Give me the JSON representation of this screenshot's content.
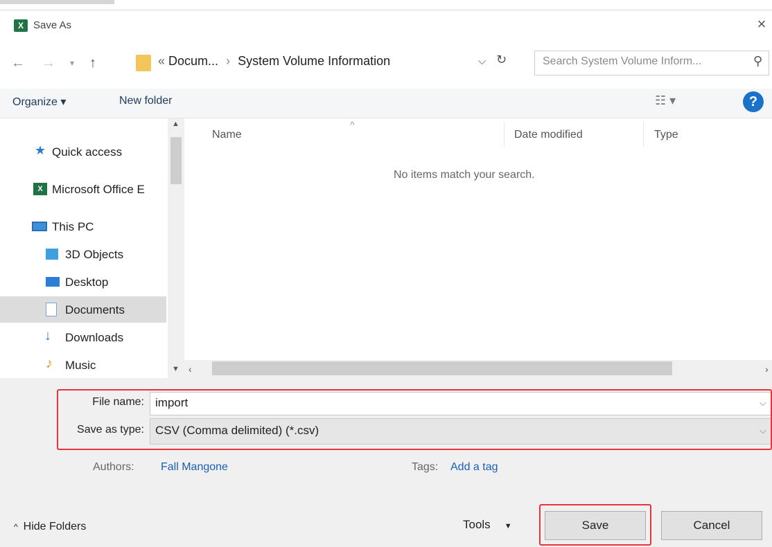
{
  "window": {
    "title": "Save As",
    "app_icon": "excel-icon"
  },
  "nav": {
    "breadcrumb_prefix": "«",
    "breadcrumb_parent": "Docum...",
    "breadcrumb_separator": "›",
    "breadcrumb_current": "System Volume Information",
    "search_placeholder": "Search System Volume Inform..."
  },
  "toolbar": {
    "organize": "Organize ▾",
    "new_folder": "New folder"
  },
  "sidebar": {
    "items": [
      {
        "label": "Quick access",
        "icon": "star-icon",
        "color": "#2b7cd3"
      },
      {
        "label": "Microsoft Office E",
        "icon": "excel-icon",
        "color": "#217346"
      },
      {
        "label": "This PC",
        "icon": "computer-icon",
        "color": "#3c8fd8"
      },
      {
        "label": "3D Objects",
        "icon": "cube-icon",
        "color": "#3fa0e0"
      },
      {
        "label": "Desktop",
        "icon": "desktop-icon",
        "color": "#2a7fd4"
      },
      {
        "label": "Documents",
        "icon": "document-icon",
        "color": "#7aa6d6"
      },
      {
        "label": "Downloads",
        "icon": "download-icon",
        "color": "#2b7cd3"
      },
      {
        "label": "Music",
        "icon": "music-icon",
        "color": "#e09a2a"
      }
    ]
  },
  "files": {
    "columns": [
      "Name",
      "Date modified",
      "Type"
    ],
    "empty_message": "No items match your search."
  },
  "form": {
    "file_name_label": "File name:",
    "file_name_value": "import",
    "save_type_label": "Save as type:",
    "save_type_value": "CSV (Comma delimited) (*.csv)",
    "authors_label": "Authors:",
    "authors_value": "Fall Mangone",
    "tags_label": "Tags:",
    "tags_value": "Add a tag"
  },
  "footer": {
    "hide_folders": "Hide Folders",
    "tools": "Tools",
    "save": "Save",
    "cancel": "Cancel"
  },
  "colors": {
    "highlight": "#e8333a",
    "link": "#1a5fb4",
    "accent": "#217346"
  }
}
